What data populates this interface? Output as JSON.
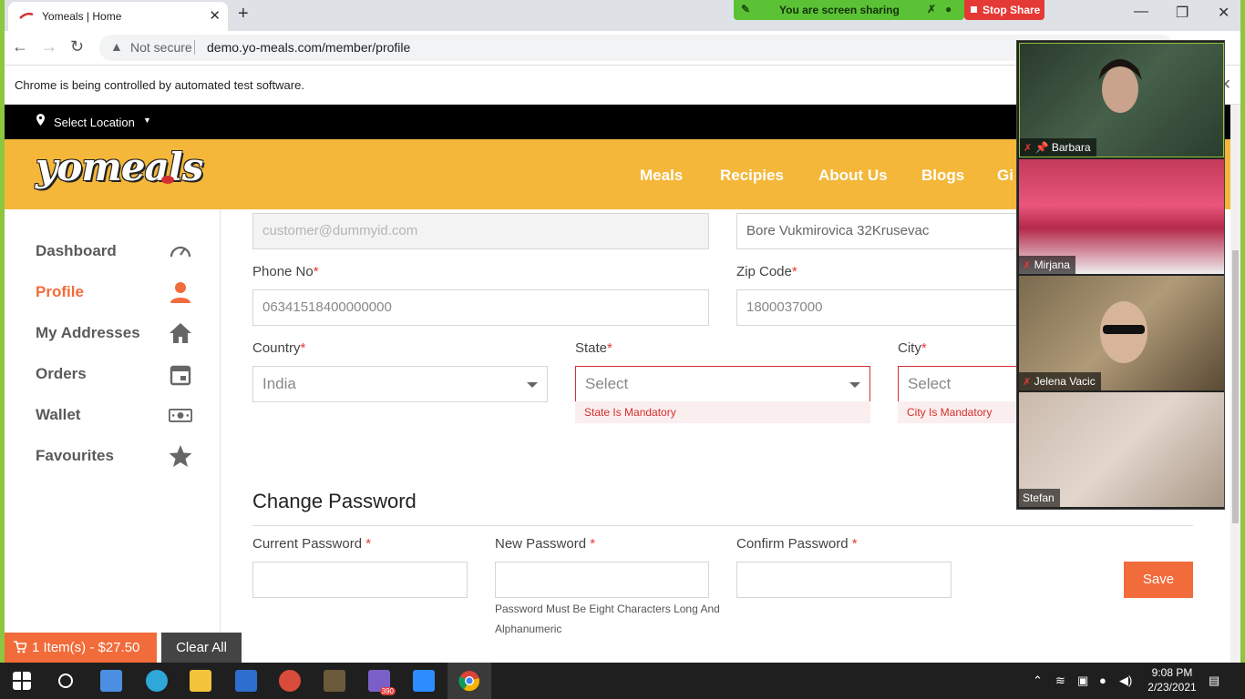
{
  "browser": {
    "tab_title": "Yomeals | Home",
    "address_security": "Not secure",
    "url": "demo.yo-meals.com/member/profile",
    "automation_notice": "Chrome is being controlled by automated test software."
  },
  "screen_share": {
    "status": "You are screen sharing",
    "stop_label": "Stop Share"
  },
  "site": {
    "location_label": "Select Location",
    "logo_text": "yomeals",
    "nav": [
      "Meals",
      "Recipies",
      "About Us",
      "Blogs",
      "Gi"
    ]
  },
  "sidebar": {
    "items": [
      {
        "label": "Dashboard",
        "icon": "speedometer-icon"
      },
      {
        "label": "Profile",
        "icon": "user-icon"
      },
      {
        "label": "My Addresses",
        "icon": "home-icon"
      },
      {
        "label": "Orders",
        "icon": "calendar-icon"
      },
      {
        "label": "Wallet",
        "icon": "money-icon"
      },
      {
        "label": "Favourites",
        "icon": "star-icon"
      }
    ]
  },
  "form": {
    "email_value": "customer@dummyid.com",
    "address_value": "Bore Vukmirovica 32Krusevac",
    "phone_label": "Phone No",
    "phone_value": "06341518400000000",
    "zip_label": "Zip Code",
    "zip_value": "1800037000",
    "country_label": "Country",
    "country_value": "India",
    "state_label": "State",
    "state_value": "Select",
    "state_error": "State Is Mandatory",
    "city_label": "City",
    "city_value": "Select",
    "city_error": "City Is Mandatory",
    "required_mark": "*"
  },
  "password": {
    "title": "Change Password",
    "current_label": "Current Password",
    "new_label": "New Password",
    "confirm_label": "Confirm Password",
    "hint": "Password Must Be Eight Characters Long And Alphanumeric",
    "save_label": "Save"
  },
  "cart": {
    "summary": "1 Item(s) - $27.50",
    "clear_label": "Clear All"
  },
  "participants": [
    "Barbara",
    "Mirjana",
    "Jelena Vacic",
    "Stefan"
  ],
  "taskbar": {
    "time": "9:08 PM",
    "date": "2/23/2021",
    "badge": "390"
  },
  "colors": {
    "accent": "#f26b3a",
    "header": "#f4b73a",
    "error": "#d32f2f",
    "share_green": "#5bc236"
  }
}
